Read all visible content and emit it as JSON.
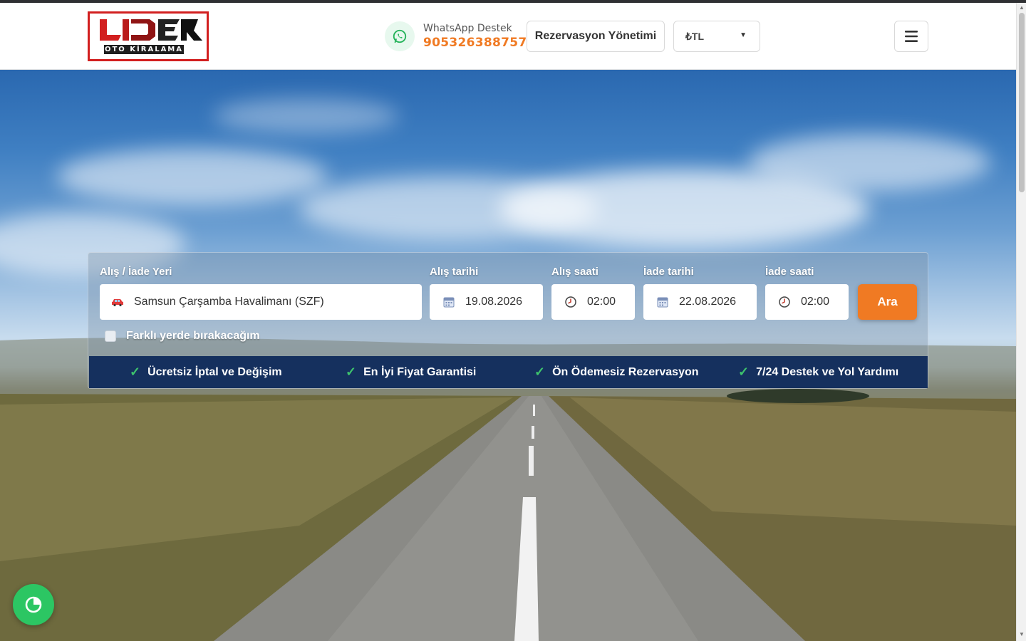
{
  "header": {
    "logo_text": "LİDER",
    "logo_subtitle": "OTO KİRALAMA",
    "whatsapp_label": "WhatsApp Destek",
    "whatsapp_phone": "905326388757",
    "reservation_button": "Rezervasyon Yönetimi",
    "currency": "₺TL",
    "menu_icon": "hamburger-icon"
  },
  "search": {
    "location_label": "Alış / İade Yeri",
    "location_value": "Samsun Çarşamba Havalimanı (SZF)",
    "pickup_date_label": "Alış tarihi",
    "pickup_date_value": "19.08.2026",
    "pickup_time_label": "Alış saati",
    "pickup_time_value": "02:00",
    "return_date_label": "İade tarihi",
    "return_date_value": "22.08.2026",
    "return_time_label": "İade saati",
    "return_time_value": "02:00",
    "search_button": "Ara",
    "different_dropoff_label": "Farklı yerde bırakacağım",
    "different_dropoff_checked": false
  },
  "features": [
    {
      "label": "Ücretsiz İptal ve Değişim"
    },
    {
      "label": "En İyi Fiyat Garantisi"
    },
    {
      "label": "Ön Ödemesiz Rezervasyon"
    },
    {
      "label": "7/24 Destek ve Yol Yardımı"
    }
  ],
  "colors": {
    "accent": "#f07a23",
    "navy": "#15305e",
    "whatsapp": "#2cc663",
    "logo_red": "#d21f1f"
  }
}
